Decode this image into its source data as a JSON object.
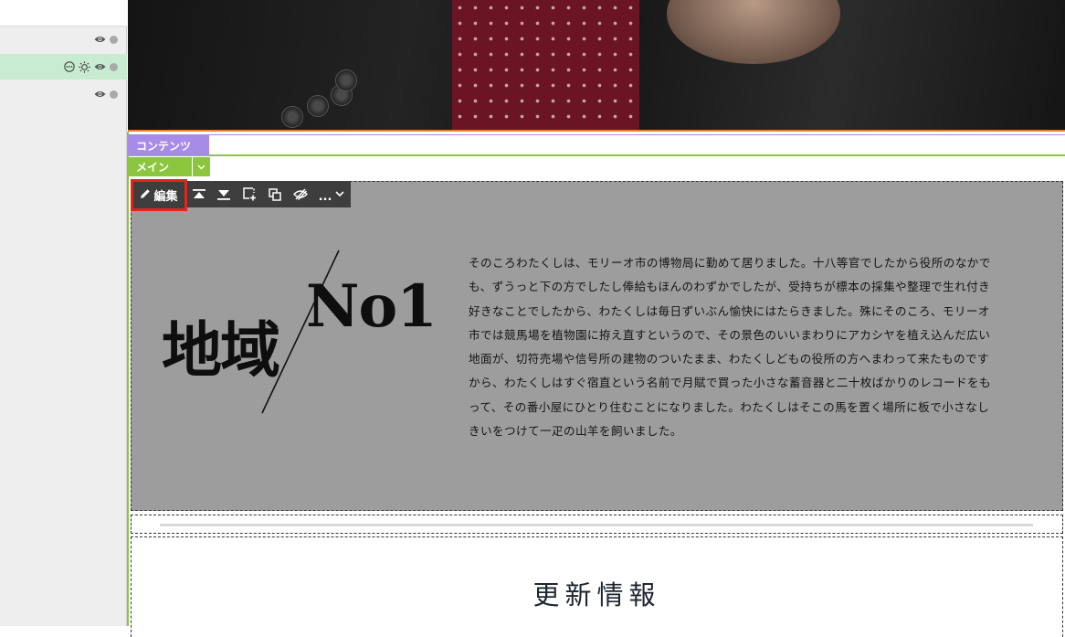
{
  "layer_panel": {
    "rows": [
      {
        "icons": [
          "eye-icon",
          "status-dot"
        ],
        "selected": false
      },
      {
        "icons": [
          "more-icon",
          "sun-icon",
          "eye-icon",
          "status-dot"
        ],
        "selected": true
      },
      {
        "icons": [
          "eye-icon",
          "status-dot"
        ],
        "selected": false
      }
    ]
  },
  "area_labels": {
    "content": "コンテンツ",
    "main": "メイン",
    "main_dropdown_icon": "chevron-down-icon"
  },
  "toolbar": {
    "edit_label": "編集",
    "edit_icon": "pencil-icon",
    "more_label": "...",
    "icons": [
      "move-top-icon",
      "move-bottom-icon",
      "add-block-icon",
      "copy-icon",
      "hide-icon",
      "chevron-down-icon"
    ]
  },
  "block": {
    "logo_left": "地域",
    "logo_right": "No1",
    "paragraph_lines": [
      "そのころわたくしは、モリーオ市の博物局に勤めて居りました。十八等官でしたから役所のなかで",
      "も、ずうっと下の方でしたし俸給もほんのわずかでしたが、受持ちが標本の採集や整理で生れ付き",
      "好きなことでしたから、わたくしは毎日ずいぶん愉快にはたらきました。殊にそのころ、モリーオ",
      "市では競馬場を植物園に拵え直すというので、その景色のいいまわりにアカシヤを植え込んだ広い",
      "地面が、切符売場や信号所の建物のついたまま、わたくしどもの役所の方へまわって来たものです",
      "から、わたくしはすぐ宿直という名前で月賦で買った小さな蓄音器と二十枚ばかりのレコードをも",
      "って、その番小屋にひとり住むことになりました。わたくしはそこの馬を置く場所に板で小さなし",
      "きいをつけて一疋の山羊を飼いました。"
    ]
  },
  "news": {
    "title": "更新情報"
  },
  "colors": {
    "content_label": "#a78be8",
    "main_label": "#8cc63f",
    "edit_highlight": "#e3241a",
    "block_bg": "#9d9d9d",
    "selected_row": "#c7ecd1"
  }
}
